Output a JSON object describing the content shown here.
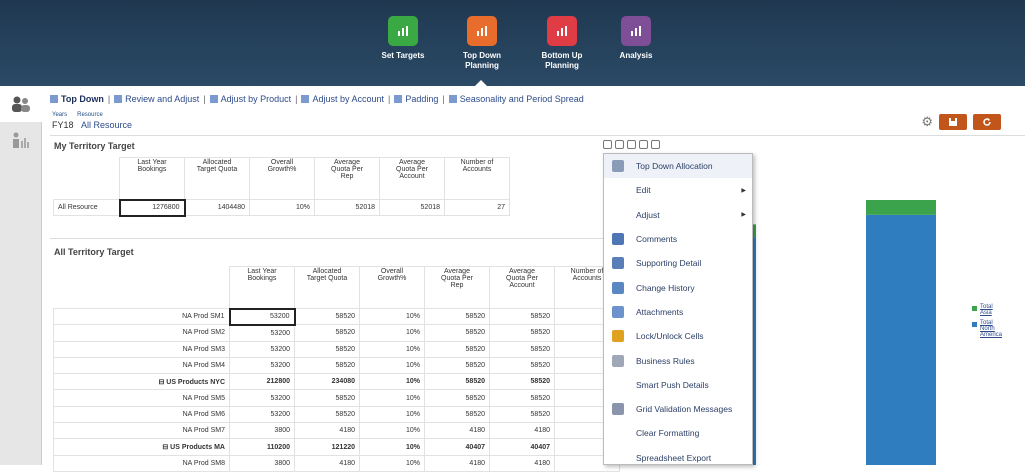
{
  "nav": [
    {
      "label": "Set Targets",
      "color": "#3aa843",
      "icon": "bar-chart-icon"
    },
    {
      "label": "Top Down\nPlanning",
      "color": "#e86c2c",
      "icon": "hierarchy-icon"
    },
    {
      "label": "Bottom Up\nPlanning",
      "color": "#e03c46",
      "icon": "layout-icon"
    },
    {
      "label": "Analysis",
      "color": "#7e4f96",
      "icon": "report-icon"
    }
  ],
  "tabs": [
    "Top Down",
    "Review and Adjust",
    "Adjust by Product",
    "Adjust by Account",
    "Padding",
    "Seasonality and Period Spread"
  ],
  "pov": {
    "years_label": "Years",
    "resource_label": "Resource",
    "year": "FY18",
    "resource": "All Resource"
  },
  "panel1": {
    "title": "My Territory Target",
    "headers": [
      "Last Year\nBookings",
      "Allocated\nTarget Quota",
      "Overall\nGrowth%",
      "Average\nQuota Per\nRep",
      "Average\nQuota Per\nAccount",
      "Number of\nAccounts"
    ],
    "rows": [
      {
        "label": "All Resource",
        "values": [
          "1276800",
          "1404480",
          "10%",
          "52018",
          "52018",
          "27"
        ]
      }
    ]
  },
  "panel2": {
    "title": "All Territory Target",
    "headers": [
      "Last Year\nBookings",
      "Allocated\nTarget Quota",
      "Overall\nGrowth%",
      "Average\nQuota Per\nRep",
      "Average\nQuota Per\nAccount",
      "Number of\nAccounts"
    ],
    "rows": [
      {
        "label": "NA Prod SM1",
        "values": [
          "53200",
          "58520",
          "10%",
          "58520",
          "58520"
        ],
        "bold": false
      },
      {
        "label": "NA Prod SM2",
        "values": [
          "53200",
          "58520",
          "10%",
          "58520",
          "58520"
        ],
        "bold": false
      },
      {
        "label": "NA Prod SM3",
        "values": [
          "53200",
          "58520",
          "10%",
          "58520",
          "58520"
        ],
        "bold": false
      },
      {
        "label": "NA Prod SM4",
        "values": [
          "53200",
          "58520",
          "10%",
          "58520",
          "58520"
        ],
        "bold": false
      },
      {
        "label": "⊟ US Products NYC",
        "values": [
          "212800",
          "234080",
          "10%",
          "58520",
          "58520"
        ],
        "bold": true
      },
      {
        "label": "NA Prod SM5",
        "values": [
          "53200",
          "58520",
          "10%",
          "58520",
          "58520"
        ],
        "bold": false
      },
      {
        "label": "NA Prod SM6",
        "values": [
          "53200",
          "58520",
          "10%",
          "58520",
          "58520"
        ],
        "bold": false
      },
      {
        "label": "NA Prod SM7",
        "values": [
          "3800",
          "4180",
          "10%",
          "4180",
          "4180"
        ],
        "bold": false
      },
      {
        "label": "⊟ US Products MA",
        "values": [
          "110200",
          "121220",
          "10%",
          "40407",
          "40407"
        ],
        "bold": true
      },
      {
        "label": "NA Prod SM8",
        "values": [
          "3800",
          "4180",
          "10%",
          "4180",
          "4180"
        ],
        "bold": false
      }
    ]
  },
  "menu": [
    {
      "label": "Top Down Allocation",
      "icon": "allocation-icon",
      "color": "#8a9bb8"
    },
    {
      "label": "Edit",
      "icon": "",
      "submenu": true
    },
    {
      "label": "Adjust",
      "icon": "",
      "submenu": true
    },
    {
      "label": "Comments",
      "icon": "comments-icon",
      "color": "#4f77b5"
    },
    {
      "label": "Supporting Detail",
      "icon": "supporting-detail-icon",
      "color": "#5a7fb8"
    },
    {
      "label": "Change History",
      "icon": "change-history-icon",
      "color": "#5a86c4"
    },
    {
      "label": "Attachments",
      "icon": "paperclip-icon",
      "color": "#6d93cc"
    },
    {
      "label": "Lock/Unlock Cells",
      "icon": "lock-icon",
      "color": "#e0a020"
    },
    {
      "label": "Business Rules",
      "icon": "rules-icon",
      "color": "#a0a8b8"
    },
    {
      "label": "Smart Push Details",
      "icon": ""
    },
    {
      "label": "Grid Validation Messages",
      "icon": "grid-validation-icon",
      "color": "#8a94aa"
    },
    {
      "label": "Clear Formatting",
      "icon": ""
    },
    {
      "label": "Spreadsheet Export",
      "icon": ""
    }
  ],
  "chart_data": {
    "type": "bar",
    "categories": [
      "",
      ""
    ],
    "series": [
      {
        "name": "Total Asia",
        "color": "#3aa34b",
        "values": [
          12,
          14
        ]
      },
      {
        "name": "Total North America",
        "color": "#2f7dbf",
        "values": [
          215,
          236
        ]
      }
    ],
    "legend": "right",
    "ylim": [
      0,
      250
    ]
  },
  "legend_labels": [
    "Total\nAsia",
    "Total\nNorth\nAmerica"
  ]
}
